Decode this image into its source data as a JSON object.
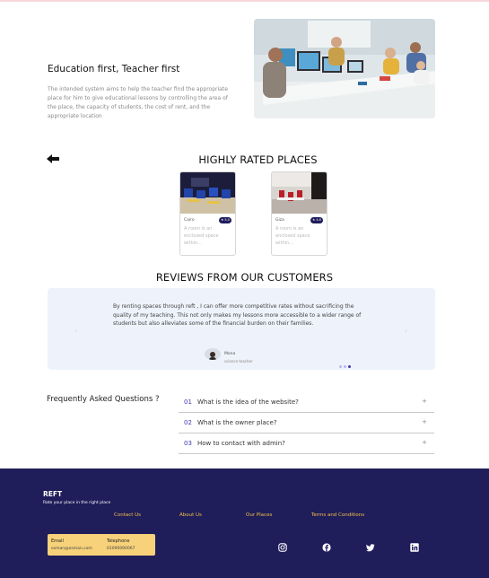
{
  "hero": {
    "title": "Education first, Teacher first",
    "description": "The intended system aims to help the teacher find the appropriate place for him to give educational lessons by controlling the area of the place, the capacity of students, the cost of rent, and the appropriate location"
  },
  "rated": {
    "title": "HIGHLY RATED PLACES",
    "cards": [
      {
        "city": "Cairo",
        "badge": "★ 5.0",
        "description": "A room is an enclosed space within..."
      },
      {
        "city": "Giza",
        "badge": "★ 4.8",
        "description": "A room is an enclosed space within..."
      }
    ]
  },
  "reviews": {
    "title": "REVIEWS FROM OUR CUSTOMERS",
    "text": "By renting spaces through reft , I can offer more competitive rates without sacrificing the quality of my teaching. This not only makes my lessons more accessible to a wider range of students but also alleviates some of the financial burden on their families.",
    "reviewer_name": "Mona",
    "reviewer_role": "science teacher",
    "prev_arrow": "‹",
    "next_arrow": "›"
  },
  "faq": {
    "heading": "Frequently Asked Questions ?",
    "items": [
      {
        "num": "01",
        "question": "What is the idea of the website?",
        "icon": "+"
      },
      {
        "num": "02",
        "question": "What is the owner place?",
        "icon": "+"
      },
      {
        "num": "03",
        "question": "How to contact with admin?",
        "icon": "+"
      }
    ]
  },
  "footer": {
    "brand": "REFT",
    "tagline": "Rate your place in the right place",
    "links": [
      "Contact Us",
      "About Us",
      "Our Places",
      "Terms and Conditions"
    ],
    "email_label": "Email",
    "email_value": "osman@osman.com",
    "phone_label": "Telephone",
    "phone_value": "01090090067"
  },
  "colors": {
    "primary": "#1f1d5a",
    "accent": "#3d35b3",
    "footer_link": "#f3c04a",
    "contact_box": "#f7d27a",
    "review_bg": "#eef2fa"
  },
  "icons": [
    "back-arrow-icon",
    "star-icon",
    "instagram-icon",
    "facebook-icon",
    "twitter-icon",
    "linkedin-icon"
  ]
}
